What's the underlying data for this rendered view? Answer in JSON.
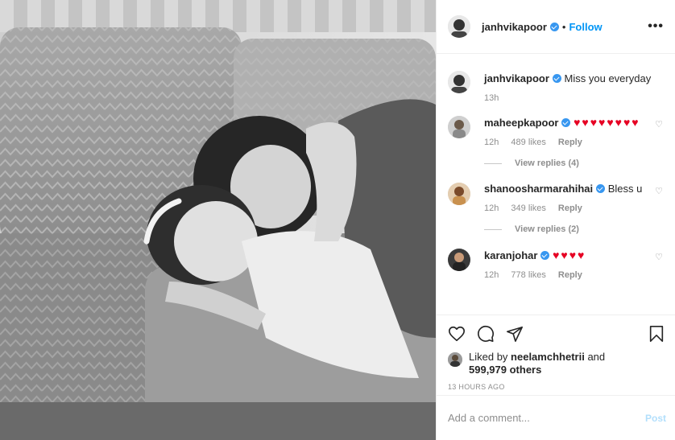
{
  "post": {
    "photo_description": "",
    "author": "janhvikapoor",
    "follow_label": "Follow",
    "separator": "•",
    "more_label": "•••"
  },
  "caption": {
    "username": "janhvikapoor",
    "text": "Miss you everyday",
    "time": "13h"
  },
  "comments": [
    {
      "username": "maheepkapoor",
      "text": "♥♥♥♥♥♥♥♥",
      "time": "12h",
      "likes": "489 likes",
      "reply": "Reply",
      "view_replies": "View replies (4)"
    },
    {
      "username": "shanoosharmarahihai",
      "text": "Bless u",
      "time": "12h",
      "likes": "349 likes",
      "reply": "Reply",
      "view_replies": "View replies (2)"
    },
    {
      "username": "karanjohar",
      "text": "♥♥♥♥",
      "time": "12h",
      "likes": "778 likes",
      "reply": "Reply"
    }
  ],
  "likes": {
    "prefix": "Liked by",
    "user": "neelamchhetrii",
    "and": "and",
    "others": "599,979 others"
  },
  "timestamp": "13 HOURS AGO",
  "add_comment": {
    "placeholder": "Add a comment...",
    "post_label": "Post"
  },
  "colors": {
    "link_blue": "#0095f6",
    "verified_blue": "#3897f0",
    "heart_red": "#e60023",
    "muted": "#8e8e8e"
  },
  "icons": [
    "heart-icon",
    "comment-icon",
    "share-icon",
    "bookmark-icon",
    "verified-icon",
    "more-icon"
  ]
}
